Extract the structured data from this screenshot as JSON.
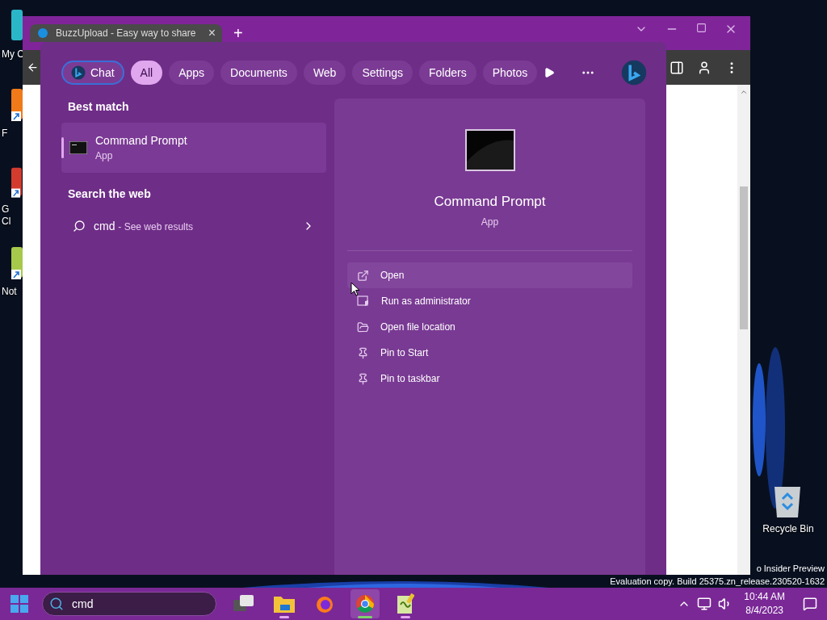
{
  "desktop": {
    "icons": [
      {
        "kind": "computer",
        "lines": [
          "My C"
        ]
      },
      {
        "kind": "firefox",
        "lines": [
          "F"
        ]
      },
      {
        "kind": "chrome",
        "lines": [
          "G",
          "Cl"
        ]
      },
      {
        "kind": "notepad",
        "lines": [
          "Not"
        ]
      }
    ],
    "recycle_bin": {
      "label": "Recycle Bin"
    },
    "evaluation_notice": [
      "o Insider Preview",
      "Evaluation copy. Build 25375.zn_release.230520-1632"
    ]
  },
  "browser": {
    "tab": {
      "title": "BuzzUpload - Easy way to share",
      "close": "×"
    },
    "new_tab": "+"
  },
  "search_panel": {
    "filters": [
      {
        "kind": "chat",
        "label": "Chat",
        "selected": false,
        "focused": true
      },
      {
        "kind": "text",
        "label": "All",
        "selected": true,
        "focused": false
      },
      {
        "kind": "text",
        "label": "Apps",
        "selected": false,
        "focused": false
      },
      {
        "kind": "text",
        "label": "Documents",
        "selected": false,
        "focused": false
      },
      {
        "kind": "text",
        "label": "Web",
        "selected": false,
        "focused": false
      },
      {
        "kind": "text",
        "label": "Settings",
        "selected": false,
        "focused": false
      },
      {
        "kind": "text",
        "label": "Folders",
        "selected": false,
        "focused": false
      },
      {
        "kind": "text",
        "label": "Photos",
        "selected": false,
        "focused": false
      }
    ],
    "best_match": {
      "heading": "Best match",
      "name": "Command Prompt",
      "type": "App",
      "selected": true
    },
    "web": {
      "heading": "Search the web",
      "query": "cmd",
      "suffix": "- See web results"
    },
    "detail": {
      "name": "Command Prompt",
      "type": "App",
      "actions": [
        {
          "kind": "open",
          "label": "Open",
          "selected": true
        },
        {
          "kind": "admin",
          "label": "Run as administrator",
          "selected": false
        },
        {
          "kind": "folder",
          "label": "Open file location",
          "selected": false
        },
        {
          "kind": "pin",
          "label": "Pin to Start",
          "selected": false
        },
        {
          "kind": "pin",
          "label": "Pin to taskbar",
          "selected": false
        }
      ]
    }
  },
  "taskbar": {
    "search": {
      "value": "cmd"
    },
    "apps": [
      {
        "kind": "task-view",
        "running": false,
        "selected": false
      },
      {
        "kind": "explorer",
        "running": true,
        "selected": false
      },
      {
        "kind": "firefox",
        "running": false,
        "selected": false
      },
      {
        "kind": "chrome",
        "running": true,
        "selected": true
      },
      {
        "kind": "notepad",
        "running": true,
        "selected": false
      }
    ],
    "time": "10:44 AM",
    "date": "8/4/2023"
  }
}
